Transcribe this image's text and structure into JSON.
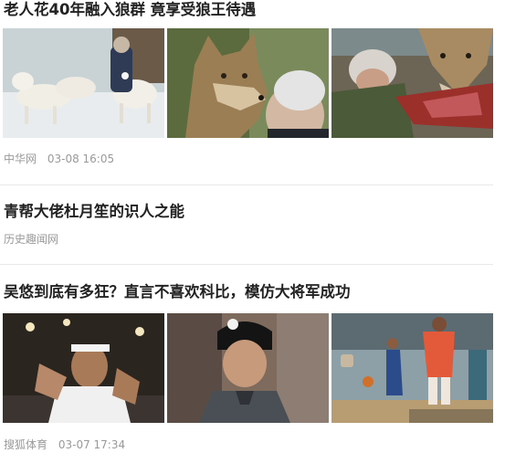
{
  "feed": {
    "items": [
      {
        "title": "老人花40年融入狼群 竟享受狼王待遇",
        "source": "中华网",
        "time": "03-08 16:05",
        "images": [
          "white-wolves-with-old-man-in-snow",
          "wolf-kissing-old-man",
          "old-man-feeding-wolf-meat"
        ]
      },
      {
        "title": "青帮大佬杜月笙的识人之能",
        "source": "历史趣闻网",
        "time": ""
      },
      {
        "title": "吴悠到底有多狂？直言不喜欢科比，模仿大将军成功",
        "source": "搜狐体育",
        "time": "03-07 17:34",
        "images": [
          "basketball-player-gesturing",
          "man-in-black-beanie-interview",
          "streetball-game-court"
        ]
      }
    ]
  }
}
